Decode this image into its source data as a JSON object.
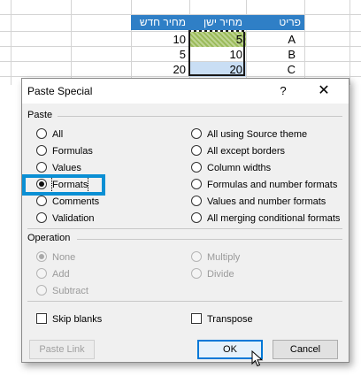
{
  "sheet": {
    "headers": [
      "מחיר חדש",
      "מחיר ישן",
      "פריט"
    ],
    "rows": [
      {
        "new": "10",
        "old": "5",
        "item": "A"
      },
      {
        "new": "5",
        "old": "10",
        "item": "B"
      },
      {
        "new": "20",
        "old": "20",
        "item": "C"
      }
    ]
  },
  "dialog": {
    "title": "Paste Special",
    "help": "?",
    "close": "✕",
    "paste_label": "Paste",
    "paste_left": [
      "All",
      "Formulas",
      "Values",
      "Formats",
      "Comments",
      "Validation"
    ],
    "paste_right": [
      "All using Source theme",
      "All except borders",
      "Column widths",
      "Formulas and number formats",
      "Values and number formats",
      "All merging conditional formats"
    ],
    "selected_paste": "Formats",
    "operation_label": "Operation",
    "operation_left": [
      "None",
      "Add",
      "Subtract"
    ],
    "operation_right": [
      "Multiply",
      "Divide"
    ],
    "skip_blanks": "Skip blanks",
    "transpose": "Transpose",
    "paste_link": "Paste Link",
    "ok": "OK",
    "cancel": "Cancel"
  },
  "colors": {
    "header_blue": "#2f7fc6",
    "highlight_border": "#0a8fd4",
    "ok_border": "#0078d7"
  }
}
